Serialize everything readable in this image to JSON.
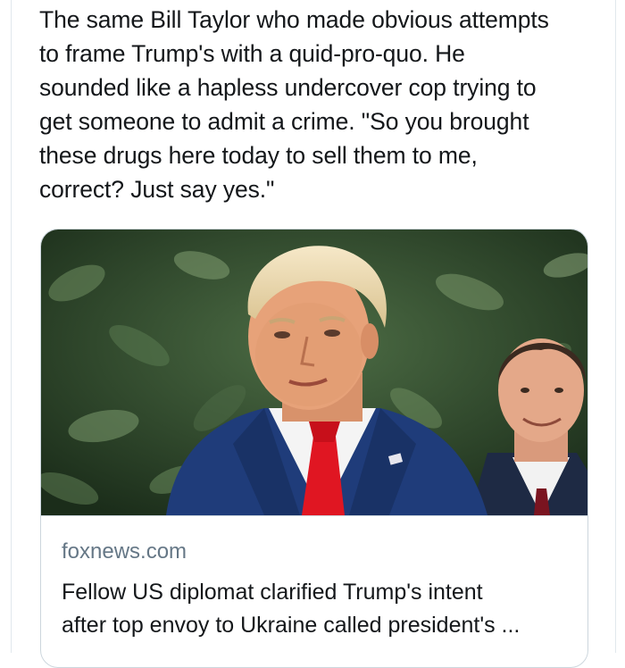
{
  "tweet": {
    "text": "The same Bill Taylor who made obvious attempts\nto frame Trump's with a quid-pro-quo. He\nsounded like a hapless undercover cop trying to\nget someone to admit a crime. \"So you brought\nthese drugs here today to sell them to me,\ncorrect? Just say yes.\""
  },
  "card": {
    "image_description_icon": "news-photo",
    "domain": "foxnews.com",
    "title": "Fellow US diplomat clarified Trump's intent\nafter top envoy to Ukraine called president's ..."
  },
  "colors": {
    "text": "#14171a",
    "muted": "#657786",
    "border": "#ccd6dd",
    "suit": "#1f3c7a",
    "tie": "#e01622",
    "foliage": "#2f4a2c"
  }
}
